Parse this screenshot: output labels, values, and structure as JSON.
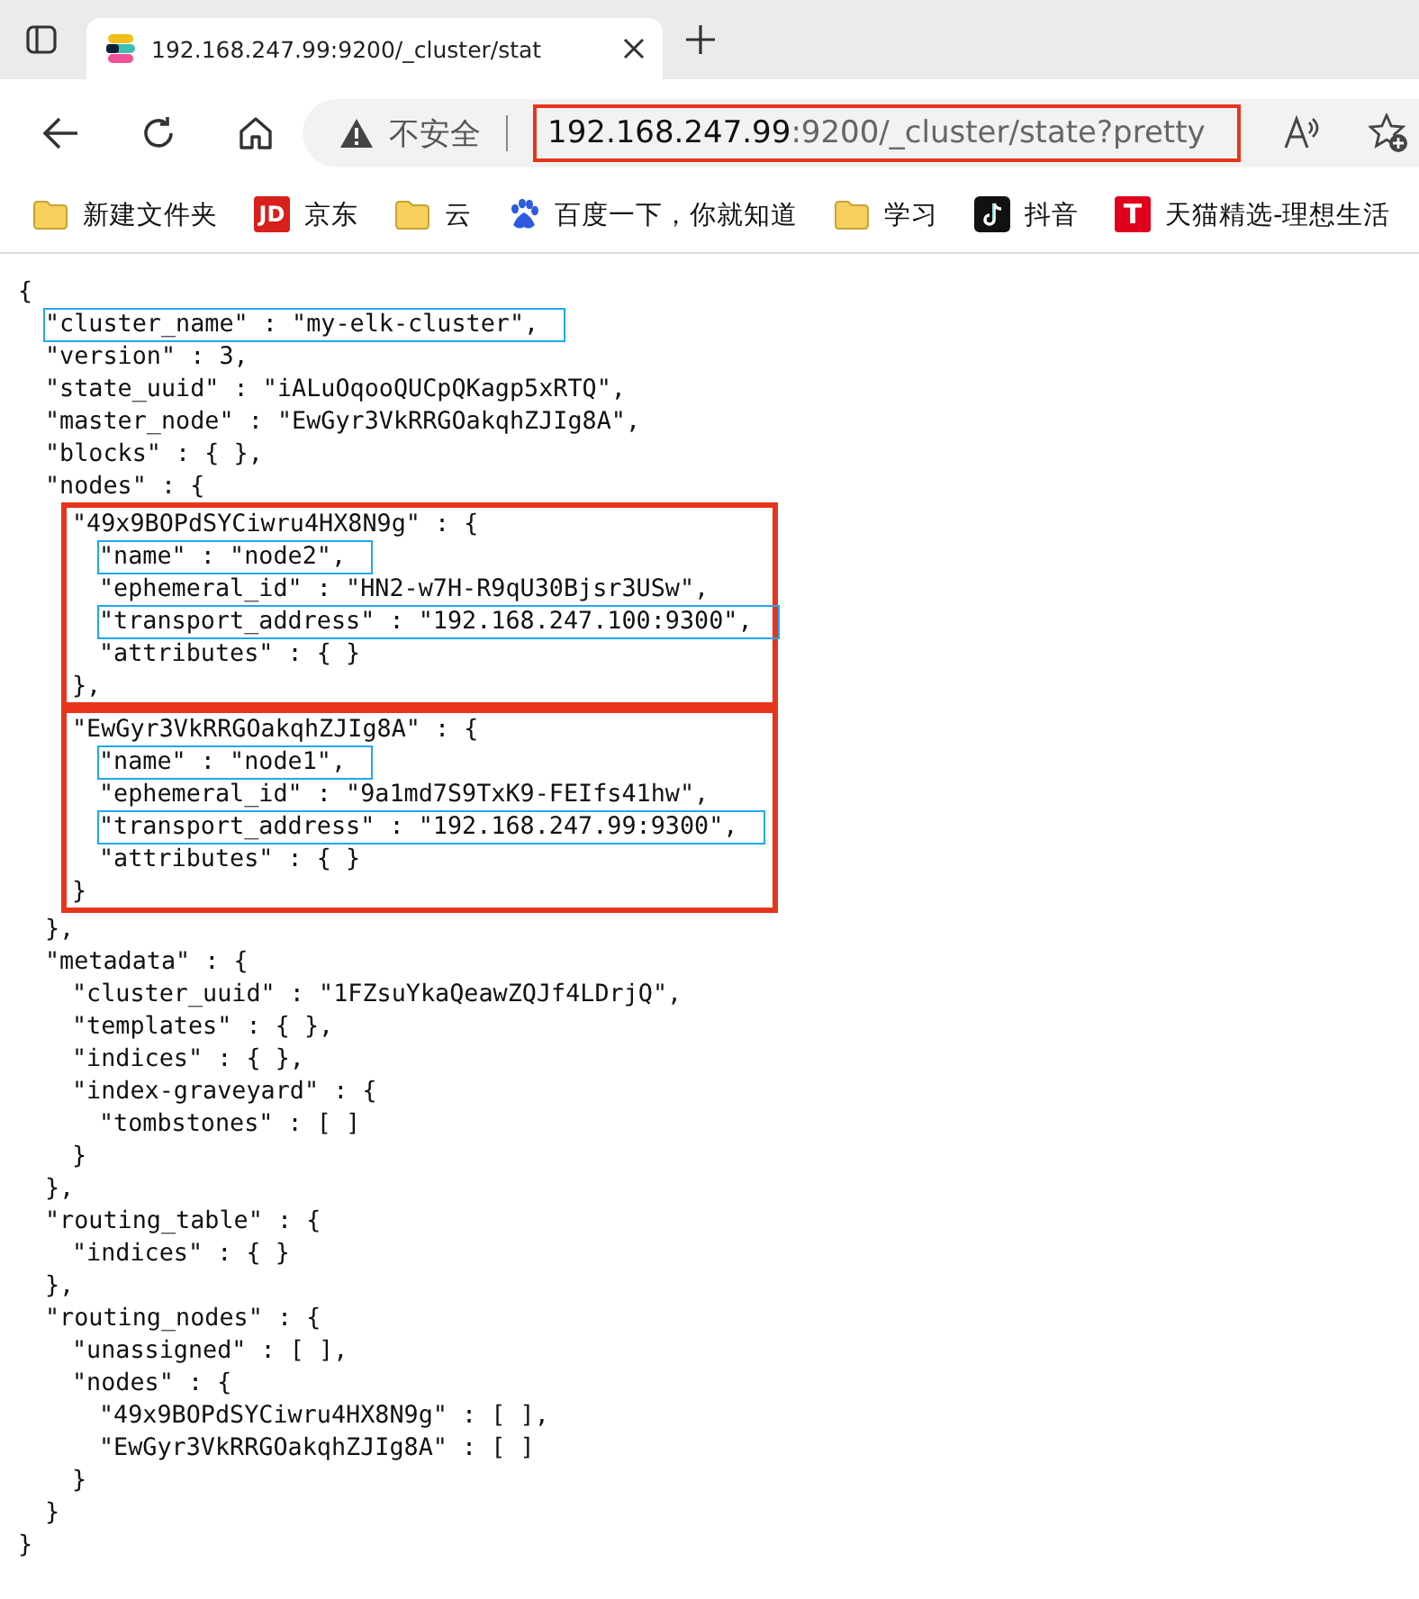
{
  "tabs": [
    {
      "title": "192.168.247.99:9200/_cluster/stat",
      "selected": true
    }
  ],
  "address_bar": {
    "security": "不安全",
    "host": "192.168.247.99",
    "path": ":9200/_cluster/state?pretty",
    "highlighted": true
  },
  "bookmarks": [
    {
      "kind": "folder",
      "label": "新建文件夹"
    },
    {
      "kind": "jd",
      "mark": "JD",
      "label": "京东"
    },
    {
      "kind": "folder",
      "label": "云"
    },
    {
      "kind": "baidu",
      "label": "百度一下，你就知道"
    },
    {
      "kind": "folder",
      "label": "学习"
    },
    {
      "kind": "tiktok",
      "label": "抖音"
    },
    {
      "kind": "tmall",
      "mark": "T",
      "label": "天猫精选-理想生活"
    }
  ],
  "json_view": {
    "text": "{",
    "close": "}",
    "outlined": false,
    "highlighted": false,
    "children": [
      {
        "text": "\"cluster_name\" : \"my-elk-cluster\",",
        "highlighted": true
      },
      {
        "text": "\"version\" : 3,",
        "highlighted": false
      },
      {
        "text": "\"state_uuid\" : \"iALuOqooQUCpQKagp5xRTQ\",",
        "highlighted": false
      },
      {
        "text": "\"master_node\" : \"EwGyr3VkRRGOakqhZJIg8A\",",
        "highlighted": false
      },
      {
        "text": "\"blocks\" : { },",
        "highlighted": false
      },
      {
        "text": "\"nodes\" : {",
        "close": "},",
        "outlined": false,
        "highlighted": false,
        "children": [
          {
            "text": "\"49x9BOPdSYCiwru4HX8N9g\" : {",
            "close": "},",
            "outlined": true,
            "highlighted": false,
            "children": [
              {
                "text": "\"name\" : \"node2\",",
                "highlighted": true
              },
              {
                "text": "\"ephemeral_id\" : \"HN2-w7H-R9qU30Bjsr3USw\",",
                "highlighted": false
              },
              {
                "text": "\"transport_address\" : \"192.168.247.100:9300\",",
                "highlighted": true
              },
              {
                "text": "\"attributes\" : { }",
                "highlighted": false
              }
            ]
          },
          {
            "text": "\"EwGyr3VkRRGOakqhZJIg8A\" : {",
            "close": "}",
            "outlined": true,
            "highlighted": false,
            "children": [
              {
                "text": "\"name\" : \"node1\",",
                "highlighted": true
              },
              {
                "text": "\"ephemeral_id\" : \"9a1md7S9TxK9-FEIfs41hw\",",
                "highlighted": false
              },
              {
                "text": "\"transport_address\" : \"192.168.247.99:9300\",",
                "highlighted": true
              },
              {
                "text": "\"attributes\" : { }",
                "highlighted": false
              }
            ]
          }
        ]
      },
      {
        "text": "\"metadata\" : {",
        "close": "},",
        "outlined": false,
        "highlighted": false,
        "children": [
          {
            "text": "\"cluster_uuid\" : \"1FZsuYkaQeawZQJf4LDrjQ\",",
            "highlighted": false
          },
          {
            "text": "\"templates\" : { },",
            "highlighted": false
          },
          {
            "text": "\"indices\" : { },",
            "highlighted": false
          },
          {
            "text": "\"index-graveyard\" : {",
            "close": "}",
            "outlined": false,
            "highlighted": false,
            "children": [
              {
                "text": "\"tombstones\" : [ ]",
                "highlighted": false
              }
            ]
          }
        ]
      },
      {
        "text": "\"routing_table\" : {",
        "close": "},",
        "outlined": false,
        "highlighted": false,
        "children": [
          {
            "text": "\"indices\" : { }",
            "highlighted": false
          }
        ]
      },
      {
        "text": "\"routing_nodes\" : {",
        "close": "}",
        "outlined": false,
        "highlighted": false,
        "children": [
          {
            "text": "\"unassigned\" : [ ],",
            "highlighted": false
          },
          {
            "text": "\"nodes\" : {",
            "close": "}",
            "outlined": false,
            "highlighted": false,
            "children": [
              {
                "text": "\"49x9BOPdSYCiwru4HX8N9g\" : [ ],",
                "highlighted": false
              },
              {
                "text": "\"EwGyr3VkRRGOakqhZJIg8A\" : [ ]",
                "highlighted": false
              }
            ]
          }
        ]
      }
    ]
  }
}
